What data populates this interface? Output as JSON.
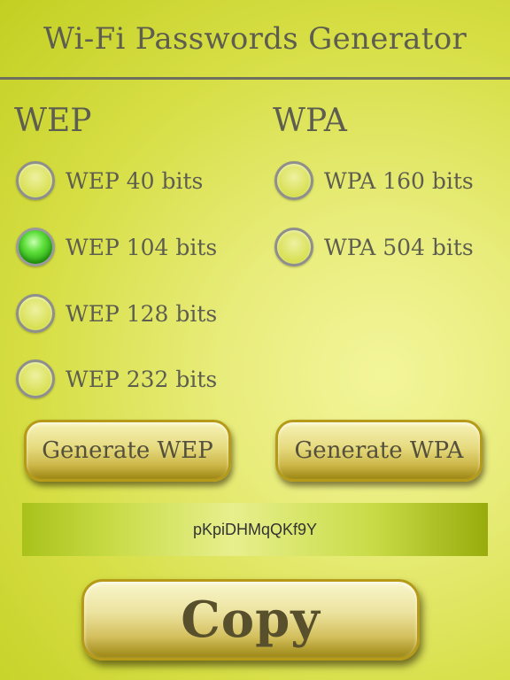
{
  "app": {
    "title": "Wi-Fi Passwords Generator"
  },
  "wep": {
    "heading": "WEP",
    "options": [
      {
        "label": "WEP 40 bits",
        "checked": false
      },
      {
        "label": "WEP 104 bits",
        "checked": true
      },
      {
        "label": "WEP 128 bits",
        "checked": false
      },
      {
        "label": "WEP 232 bits",
        "checked": false
      }
    ],
    "generate_label": "Generate WEP"
  },
  "wpa": {
    "heading": "WPA",
    "options": [
      {
        "label": "WPA 160 bits",
        "checked": false
      },
      {
        "label": "WPA 504 bits",
        "checked": false
      }
    ],
    "generate_label": "Generate WPA"
  },
  "output": {
    "password": "pKpiDHMqQKf9Y"
  },
  "copy": {
    "label": "Copy"
  },
  "colors": {
    "background": "#d6de44",
    "text": "#5e5e50",
    "selected_radio": "#2aa812",
    "button_border": "#b69b19"
  }
}
